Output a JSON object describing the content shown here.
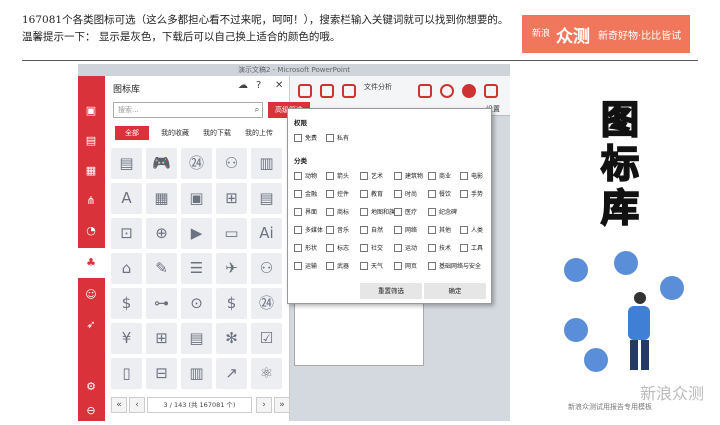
{
  "article": {
    "text": "167081个各类图标可选（这么多都担心看不过来呢，呵呵！），搜索栏输入关键词就可以找到你想要的。温馨提示一下： 显示是灰色，下载后可以自己换上适合的颜色的哦。"
  },
  "logo": {
    "brand_small": "新浪",
    "brand": "众测",
    "slogan": "新奇好物·比比皆试"
  },
  "window": {
    "title": "演示文稿2 - Microsoft PowerPoint",
    "file_analysis": "文件分析",
    "settings": "设置"
  },
  "panel": {
    "title": "图标库",
    "search_placeholder": "搜索...",
    "adv_filter": "高级筛选",
    "tabs": [
      "全部",
      "我的收藏",
      "我的下载",
      "我的上传"
    ],
    "pager": {
      "first": "«",
      "prev": "‹",
      "info": "3 / 143 (共 167081 个)",
      "next": "›",
      "last": "»"
    }
  },
  "filter": {
    "section1": "权限",
    "perm": [
      "免费",
      "私有"
    ],
    "section2": "分类",
    "rows": [
      [
        "动物",
        "箭头",
        "艺术",
        "建筑物",
        "商业",
        "电影"
      ],
      [
        "金融",
        "控件",
        "教育",
        "时尚",
        "餐饮",
        "手势"
      ],
      [
        "界面",
        "商标",
        "地图和旗子",
        "医疗",
        "纪念碑"
      ],
      [
        "多媒体",
        "音乐",
        "自然",
        "网络",
        "其他",
        "人类"
      ],
      [
        "形状",
        "标志",
        "社交",
        "运动",
        "技术",
        "工具"
      ],
      [
        "运输",
        "武器",
        "天气",
        "网页",
        "基础网络与安全"
      ]
    ],
    "reset": "重置筛选",
    "ok": "确定"
  },
  "right": {
    "title_chars": [
      "图",
      "标",
      "库"
    ],
    "caption": "新浪众测试用报告专用模板",
    "watermark": "新浪众测"
  },
  "colors": {
    "red": "#d9323a",
    "logo": "#f0775c"
  }
}
